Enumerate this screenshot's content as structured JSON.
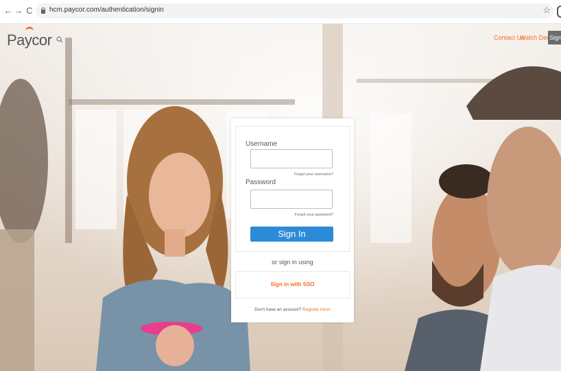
{
  "browser": {
    "back": "←",
    "forward": "→",
    "reload": "C",
    "url": "hcm.paycor.com/authentication/signin",
    "bookmark": "☆"
  },
  "header": {
    "logo": "Paycor",
    "nav": {
      "contact": "Contact Us",
      "watch_demo": "Watch Demo",
      "sign_in": "Sign In"
    }
  },
  "login": {
    "username_label": "Username",
    "username_value": "",
    "forgot_username": "Forgot your username?",
    "password_label": "Password",
    "password_value": "",
    "forgot_password": "Forgot your password?",
    "sign_in_button": "Sign In",
    "or_text": "or sign in using",
    "sso_button": "Sign in with SSO",
    "register_prompt": "Don't have an account?",
    "register_link": "Register here!"
  },
  "colors": {
    "brand_orange": "#f36f21",
    "primary_blue": "#2b8bd8"
  }
}
